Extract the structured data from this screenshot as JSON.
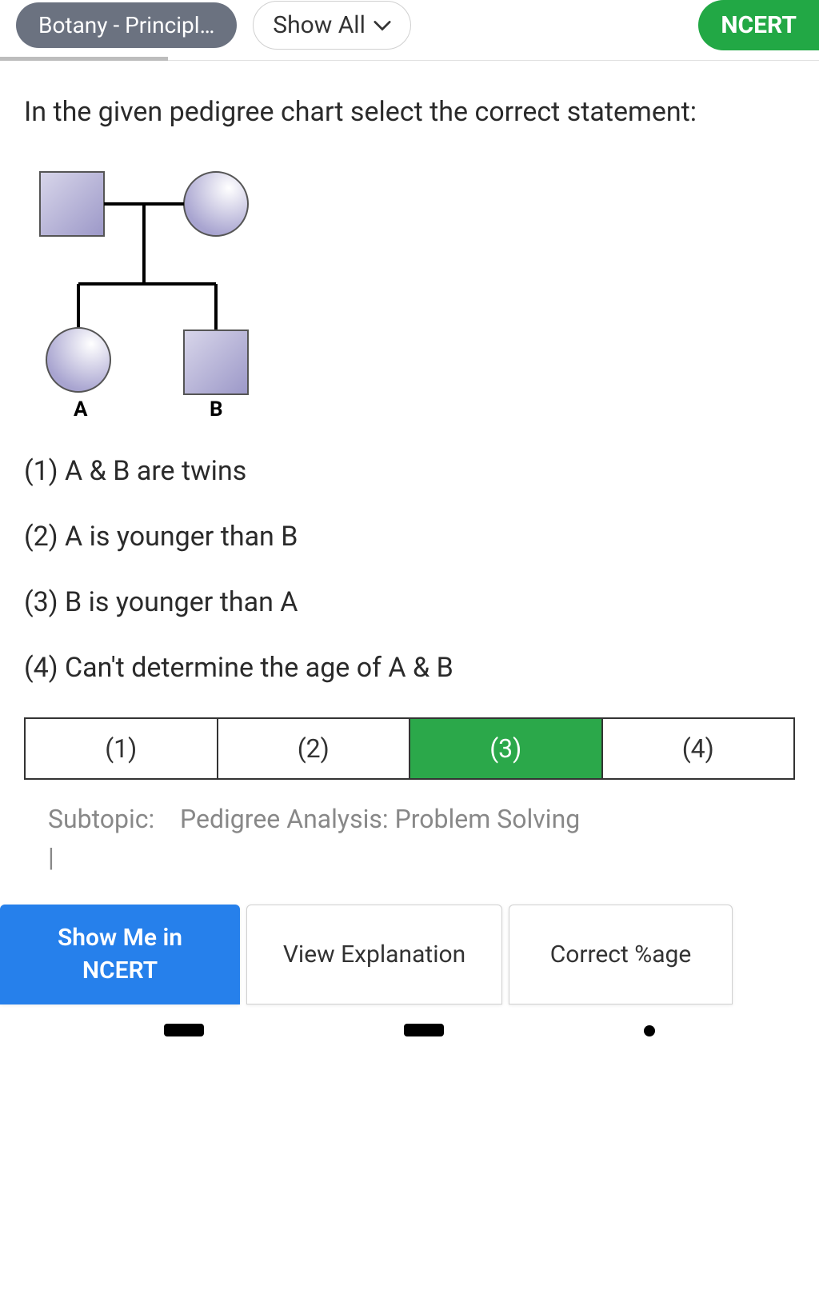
{
  "header": {
    "subject_pill": "Botany - Principl…",
    "show_all_label": "Show All",
    "ncert_label": "NCERT"
  },
  "question": {
    "text": "In the given pedigree chart select the correct statement:"
  },
  "pedigree": {
    "labels": {
      "A": "A",
      "B": "B"
    }
  },
  "options": [
    {
      "num": "(1)",
      "text": "A & B are twins"
    },
    {
      "num": "(2)",
      "text": "A is younger than B"
    },
    {
      "num": "(3)",
      "text": "B is younger than A"
    },
    {
      "num": "(4)",
      "text": "Can't determine the age of A & B"
    }
  ],
  "answer_cells": [
    {
      "label": "(1)",
      "selected": false
    },
    {
      "label": "(2)",
      "selected": false
    },
    {
      "label": "(3)",
      "selected": true
    },
    {
      "label": "(4)",
      "selected": false
    }
  ],
  "subtopic": {
    "label": "Subtopic:",
    "value": "Pedigree Analysis: Problem Solving"
  },
  "buttons": {
    "show_ncert_line1": "Show Me in",
    "show_ncert_line2": "NCERT",
    "view_explanation": "View Explanation",
    "correct_pct": "Correct %age"
  },
  "colors": {
    "accent_green": "#2ba84a",
    "accent_blue": "#2680eb",
    "pedigree_fill": "#b8b5d9",
    "pedigree_stroke": "#555"
  }
}
